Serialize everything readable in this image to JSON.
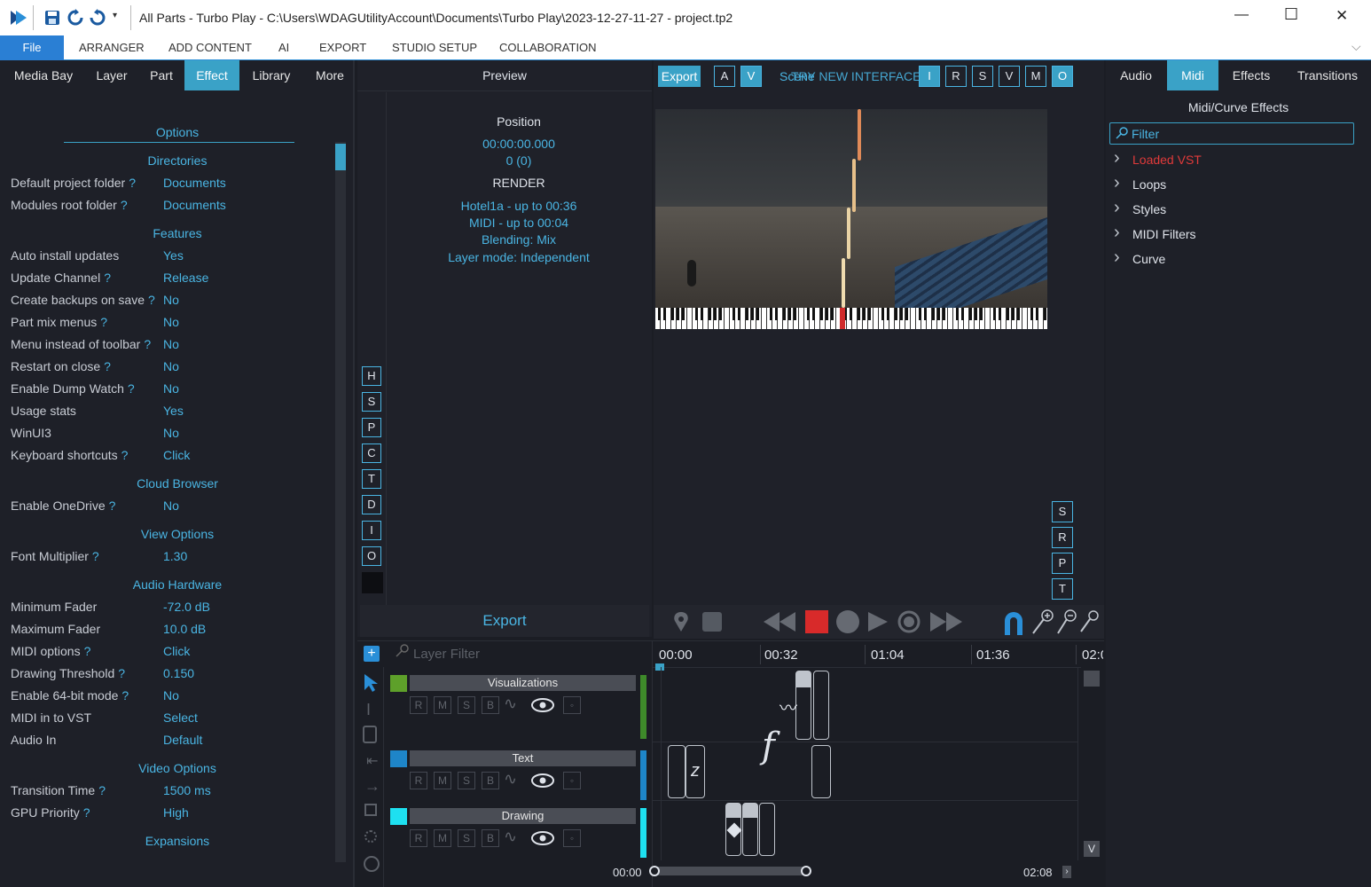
{
  "window": {
    "title": "All Parts - Turbo Play - C:\\Users\\WDAGUtilityAccount\\Documents\\Turbo Play\\2023-12-27-11-27 - project.tp2",
    "controls": {
      "minimize": "—",
      "maximize": "☐",
      "close": "✕"
    }
  },
  "menu": {
    "file": "File",
    "items": [
      "ARRANGER",
      "ADD CONTENT",
      "AI",
      "EXPORT",
      "STUDIO SETUP",
      "COLLABORATION"
    ]
  },
  "left_tabs": [
    "Media Bay",
    "Layer",
    "Part",
    "Effect",
    "Library",
    "More"
  ],
  "options": {
    "title": "Options",
    "sections": {
      "directories": "Directories",
      "features": "Features",
      "cloud": "Cloud Browser",
      "view": "View Options",
      "audio": "Audio Hardware",
      "video": "Video Options",
      "expansions": "Expansions"
    },
    "rows": [
      {
        "k": "Default project folder",
        "q": "?",
        "v": "Documents"
      },
      {
        "k": "Modules root folder",
        "q": "?",
        "v": "Documents"
      },
      {
        "k": "Auto install updates",
        "q": "",
        "v": "Yes"
      },
      {
        "k": "Update Channel",
        "q": "?",
        "v": "Release"
      },
      {
        "k": "Create backups on save",
        "q": "?",
        "v": "No"
      },
      {
        "k": "Part mix menus",
        "q": "?",
        "v": "No"
      },
      {
        "k": "Menu instead of toolbar",
        "q": "?",
        "v": "No"
      },
      {
        "k": "Restart on close",
        "q": "?",
        "v": "No"
      },
      {
        "k": "Enable Dump Watch",
        "q": "?",
        "v": "No"
      },
      {
        "k": "Usage stats",
        "q": "",
        "v": "Yes"
      },
      {
        "k": "WinUI3",
        "q": "",
        "v": "No"
      },
      {
        "k": "Keyboard shortcuts",
        "q": "?",
        "v": "Click"
      },
      {
        "k": "Enable OneDrive",
        "q": "?",
        "v": "No"
      },
      {
        "k": "Font Multiplier",
        "q": "?",
        "v": "1.30"
      },
      {
        "k": "Minimum Fader",
        "q": "",
        "v": "-72.0 dB"
      },
      {
        "k": "Maximum Fader",
        "q": "",
        "v": "10.0 dB"
      },
      {
        "k": "MIDI options",
        "q": "?",
        "v": "Click"
      },
      {
        "k": "Drawing Threshold",
        "q": "?",
        "v": "0.150"
      },
      {
        "k": "Enable 64-bit mode",
        "q": "?",
        "v": "No"
      },
      {
        "k": "MIDI in to VST",
        "q": "",
        "v": "Select"
      },
      {
        "k": "Audio In",
        "q": "",
        "v": "Default"
      },
      {
        "k": "Transition Time",
        "q": "?",
        "v": "1500 ms"
      },
      {
        "k": "GPU Priority",
        "q": "?",
        "v": "High"
      }
    ]
  },
  "preview": {
    "title": "Preview",
    "position_label": "Position",
    "time": "00:00:00.000",
    "frame": "0 (0)",
    "render_label": "RENDER",
    "lines": [
      "Hotel1a - up to 00:36",
      "MIDI - up to 00:04",
      "Blending: Mix",
      "Layer mode: Independent"
    ],
    "export": "Export",
    "side_buttons": [
      "H",
      "S",
      "P",
      "C",
      "T",
      "D",
      "I",
      "O"
    ]
  },
  "video_toolbar": {
    "export": "Export",
    "buttons_left": [
      "A",
      "V"
    ],
    "overlay_text_a": "Scene",
    "overlay_text_b": "TRY NEW INTERFACE",
    "buttons_right": [
      "I",
      "R",
      "S",
      "V",
      "M",
      "O"
    ],
    "right_side": [
      "S",
      "R",
      "P",
      "T"
    ]
  },
  "right_panel": {
    "tabs": [
      "Audio",
      "Midi",
      "Effects",
      "Transitions"
    ],
    "heading": "Midi/Curve Effects",
    "filter_placeholder": "Filter",
    "tree": [
      {
        "label": "Loaded VST",
        "color": "#e03a3a"
      },
      {
        "label": "Loops",
        "color": "#dfe3ea"
      },
      {
        "label": "Styles",
        "color": "#dfe3ea"
      },
      {
        "label": "MIDI Filters",
        "color": "#dfe3ea"
      },
      {
        "label": "Curve",
        "color": "#dfe3ea"
      }
    ]
  },
  "timeline": {
    "layer_filter_placeholder": "Layer Filter",
    "ticks": [
      "00:00",
      "00:32",
      "01:04",
      "01:36",
      "02:0"
    ],
    "tracks": [
      {
        "name": "Visualizations",
        "color": "#5ea02a",
        "bar": "#3e8a2a"
      },
      {
        "name": "Text",
        "color": "#1e85c8",
        "bar": "#1e85c8"
      },
      {
        "name": "Drawing",
        "color": "#1ee0f0",
        "bar": "#1ee0f0"
      }
    ],
    "track_buttons": [
      "R",
      "M",
      "S",
      "B"
    ],
    "start_time": "00:00",
    "end_time": "02:08"
  },
  "colors": {
    "accent": "#3aa2c7",
    "text_accent": "#4ab5e3",
    "panel": "#1e2028"
  }
}
